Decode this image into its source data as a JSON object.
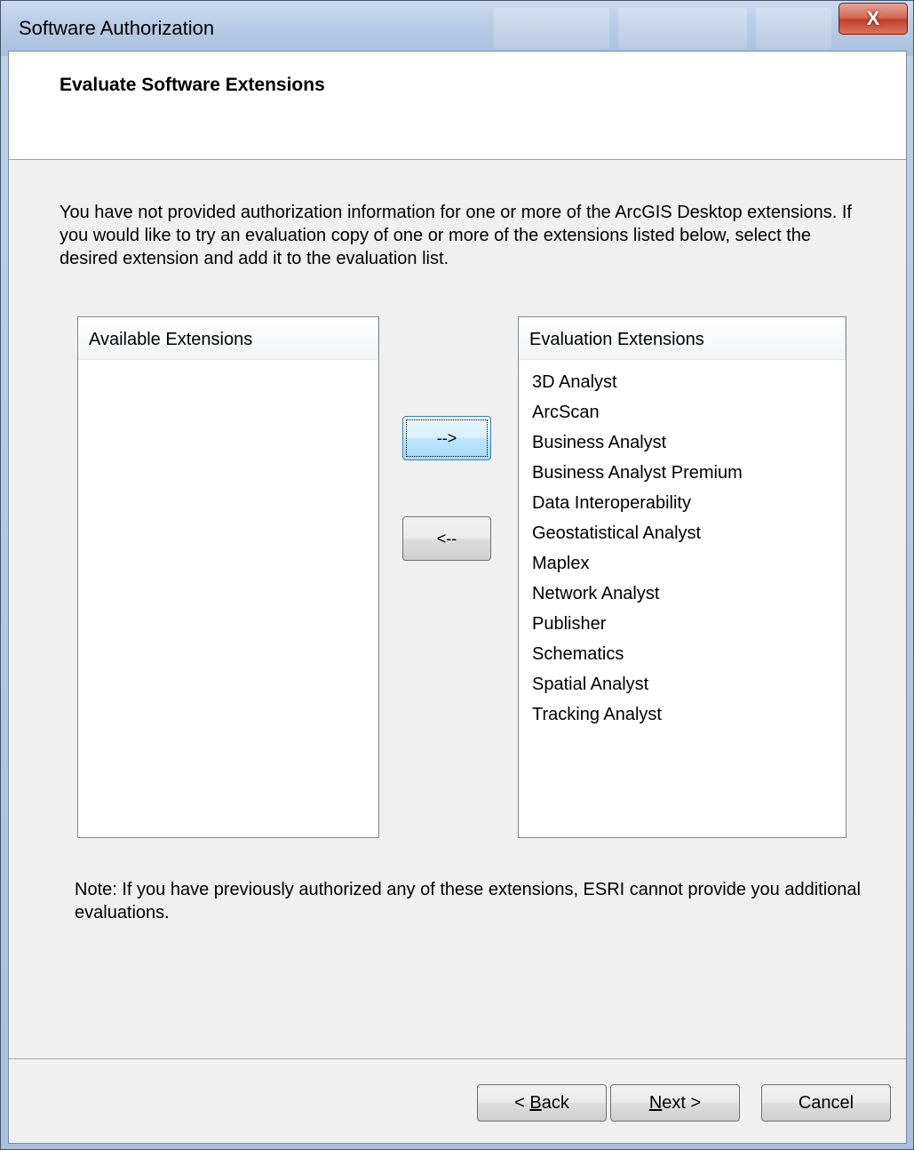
{
  "window": {
    "title": "Software Authorization",
    "close_glyph": "X"
  },
  "header": {
    "title": "Evaluate Software Extensions"
  },
  "intro_text": "You have not provided authorization information for one or more of the ArcGIS Desktop extensions.  If you would like to try an evaluation copy of one or more of the extensions listed below, select the desired extension and add it to the evaluation list.",
  "available": {
    "header": "Available Extensions",
    "items": []
  },
  "evaluation": {
    "header": "Evaluation Extensions",
    "items": [
      "3D Analyst",
      "ArcScan",
      "Business Analyst",
      "Business Analyst Premium",
      "Data Interoperability",
      "Geostatistical Analyst",
      "Maplex",
      "Network Analyst",
      "Publisher",
      "Schematics",
      "Spatial Analyst",
      "Tracking Analyst"
    ]
  },
  "buttons": {
    "add_label": "-->",
    "remove_label": "<--",
    "back": {
      "prefix": "< ",
      "mnemonic": "B",
      "rest": "ack"
    },
    "next": {
      "mnemonic": "N",
      "rest": "ext >"
    },
    "cancel": "Cancel"
  },
  "note_text": "Note:  If you have previously authorized any of these extensions, ESRI cannot provide you additional evaluations."
}
